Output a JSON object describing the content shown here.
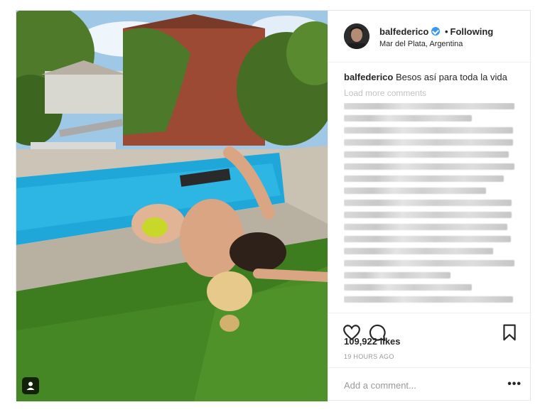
{
  "post": {
    "user": {
      "username": "balfederico",
      "following_label": "Following",
      "separator": "•",
      "location": "Mar del Plata, Argentina",
      "verified": true
    },
    "caption": {
      "username": "balfederico",
      "text": "Besos así para toda la vida"
    },
    "load_more_label": "Load more comments",
    "likes": "109,922 likes",
    "time": "19 HOURS AGO",
    "add_comment": {
      "placeholder": "Add a comment..."
    },
    "more_options_label": "•••",
    "colors": {
      "accent": "#3897f0",
      "text": "#262626",
      "muted": "#999999",
      "pool": "#1ea7d8",
      "grass": "#3e7d1f"
    },
    "icons": [
      "user-tag-icon",
      "verified-badge-icon",
      "heart-icon",
      "comment-icon",
      "bookmark-icon",
      "more-options-icon"
    ]
  }
}
